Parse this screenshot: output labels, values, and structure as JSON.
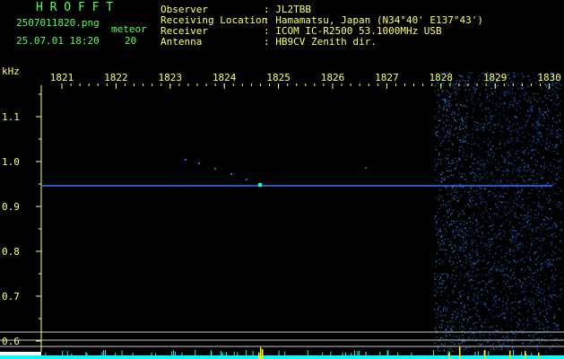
{
  "header": {
    "brand": "H R O F F T",
    "filename": "2507011820.png",
    "timestamp": "25.07.01 18:20",
    "count_label": "meteor",
    "count_value": "20",
    "info_labels": [
      "Observer",
      "Receiving Location",
      "Receiver",
      "Antenna"
    ],
    "info_values": [
      ": JL2TBB",
      ": Hamamatsu, Japan (N34°40' E137°43')",
      ": ICOM IC-R2500 53.1000MHz USB",
      ": HB9CV Zenith dir."
    ]
  },
  "spectrogram": {
    "y_unit": "kHz",
    "x_ticks": [
      "1821",
      "1822",
      "1823",
      "1824",
      "1825",
      "1826",
      "1827",
      "1828",
      "1829",
      "1830"
    ],
    "y_ticks": [
      "1.1",
      "1.0",
      "0.9",
      "0.8",
      "0.7",
      "0.6"
    ],
    "colors": {
      "background": "#000000",
      "axis_text": "#ffff66",
      "label_text": "#55ff55",
      "carrier": "#3a6cff",
      "noise": "#2a4cff",
      "bottom_band": "#00ffff",
      "bottom_band_spike": "#ffff00"
    }
  }
}
